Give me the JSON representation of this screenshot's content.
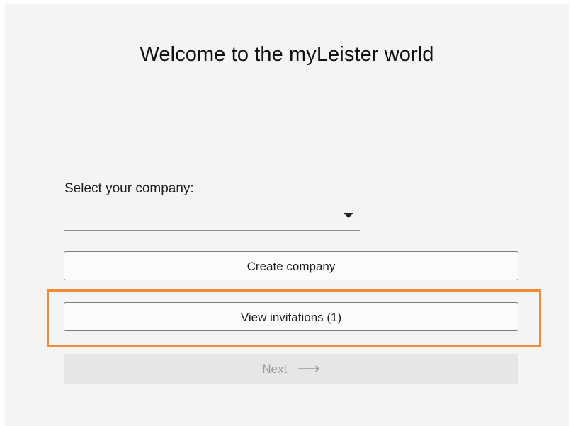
{
  "page": {
    "title": "Welcome to the myLeister world"
  },
  "company_select": {
    "label": "Select your company:",
    "selected_value": ""
  },
  "buttons": {
    "create_company": "Create company",
    "view_invitations": "View invitations (1)",
    "next": "Next",
    "next_arrow": "⟶"
  },
  "colors": {
    "highlight": "#ef8b3a",
    "panel_background": "#f4f4f4",
    "disabled_button": "#e6e6e6"
  }
}
